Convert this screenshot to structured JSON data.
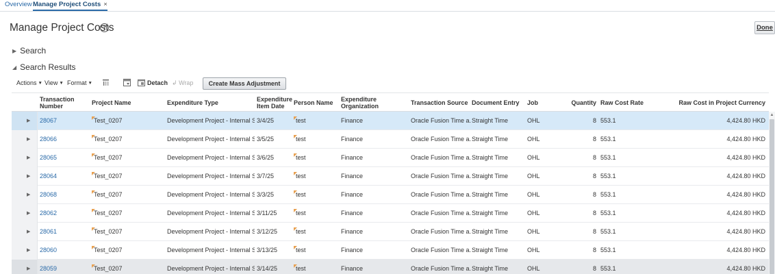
{
  "tabs": [
    {
      "label": "Overview",
      "active": false
    },
    {
      "label": "Manage Project Costs",
      "active": true,
      "close": "×"
    }
  ],
  "page": {
    "title": "Manage Project Costs",
    "help": "?",
    "done_label": "Done"
  },
  "sections": {
    "search": "Search",
    "results": "Search Results"
  },
  "toolbar": {
    "actions": "Actions",
    "view": "View",
    "format": "Format",
    "detach": "Detach",
    "wrap": "Wrap",
    "mass_adjustment": "Create Mass Adjustment"
  },
  "table": {
    "columns": [
      "Transaction Number",
      "Project Name",
      "Expenditure Type",
      "Expenditure Item Date",
      "Person Name",
      "Expenditure Organization",
      "Transaction Source",
      "Document Entry",
      "Job",
      "Quantity",
      "Raw Cost Rate",
      "Raw Cost in Project Currency"
    ],
    "rows": [
      {
        "number": "28067",
        "project": "Test_0207",
        "type": "Development Project - Internal Staf...",
        "date": "3/4/25",
        "person": "test",
        "org": "Finance",
        "source": "Oracle Fusion Time a...",
        "entry": "Straight Time",
        "job": "OHL",
        "qty": "8",
        "rate": "553.1",
        "cost": "4,424.80 HKD"
      },
      {
        "number": "28066",
        "project": "Test_0207",
        "type": "Development Project - Internal Staf...",
        "date": "3/5/25",
        "person": "test",
        "org": "Finance",
        "source": "Oracle Fusion Time a...",
        "entry": "Straight Time",
        "job": "OHL",
        "qty": "8",
        "rate": "553.1",
        "cost": "4,424.80 HKD"
      },
      {
        "number": "28065",
        "project": "Test_0207",
        "type": "Development Project - Internal Staf...",
        "date": "3/6/25",
        "person": "test",
        "org": "Finance",
        "source": "Oracle Fusion Time a...",
        "entry": "Straight Time",
        "job": "OHL",
        "qty": "8",
        "rate": "553.1",
        "cost": "4,424.80 HKD"
      },
      {
        "number": "28064",
        "project": "Test_0207",
        "type": "Development Project - Internal Staf...",
        "date": "3/7/25",
        "person": "test",
        "org": "Finance",
        "source": "Oracle Fusion Time a...",
        "entry": "Straight Time",
        "job": "OHL",
        "qty": "8",
        "rate": "553.1",
        "cost": "4,424.80 HKD"
      },
      {
        "number": "28068",
        "project": "Test_0207",
        "type": "Development Project - Internal Staf...",
        "date": "3/3/25",
        "person": "test",
        "org": "Finance",
        "source": "Oracle Fusion Time a...",
        "entry": "Straight Time",
        "job": "OHL",
        "qty": "8",
        "rate": "553.1",
        "cost": "4,424.80 HKD"
      },
      {
        "number": "28062",
        "project": "Test_0207",
        "type": "Development Project - Internal Staf...",
        "date": "3/11/25",
        "person": "test",
        "org": "Finance",
        "source": "Oracle Fusion Time a...",
        "entry": "Straight Time",
        "job": "OHL",
        "qty": "8",
        "rate": "553.1",
        "cost": "4,424.80 HKD"
      },
      {
        "number": "28061",
        "project": "Test_0207",
        "type": "Development Project - Internal Staf...",
        "date": "3/12/25",
        "person": "test",
        "org": "Finance",
        "source": "Oracle Fusion Time a...",
        "entry": "Straight Time",
        "job": "OHL",
        "qty": "8",
        "rate": "553.1",
        "cost": "4,424.80 HKD"
      },
      {
        "number": "28060",
        "project": "Test_0207",
        "type": "Development Project - Internal Staf...",
        "date": "3/13/25",
        "person": "test",
        "org": "Finance",
        "source": "Oracle Fusion Time a...",
        "entry": "Straight Time",
        "job": "OHL",
        "qty": "8",
        "rate": "553.1",
        "cost": "4,424.80 HKD"
      },
      {
        "number": "28059",
        "project": "Test_0207",
        "type": "Development Project - Internal Staf...",
        "date": "3/14/25",
        "person": "test",
        "org": "Finance",
        "source": "Oracle Fusion Time a...",
        "entry": "Straight Time",
        "job": "OHL",
        "qty": "8",
        "rate": "553.1",
        "cost": "4,424.80 HKD"
      }
    ]
  },
  "icons": {
    "expand": "triangle-right-icon",
    "collapse": "triangle-down-icon",
    "attachment_flag": "orange-corner-flag-icon"
  },
  "colors": {
    "link": "#2a6aa8",
    "selected_row": "#d6e9f8",
    "flag": "#e8a050"
  }
}
